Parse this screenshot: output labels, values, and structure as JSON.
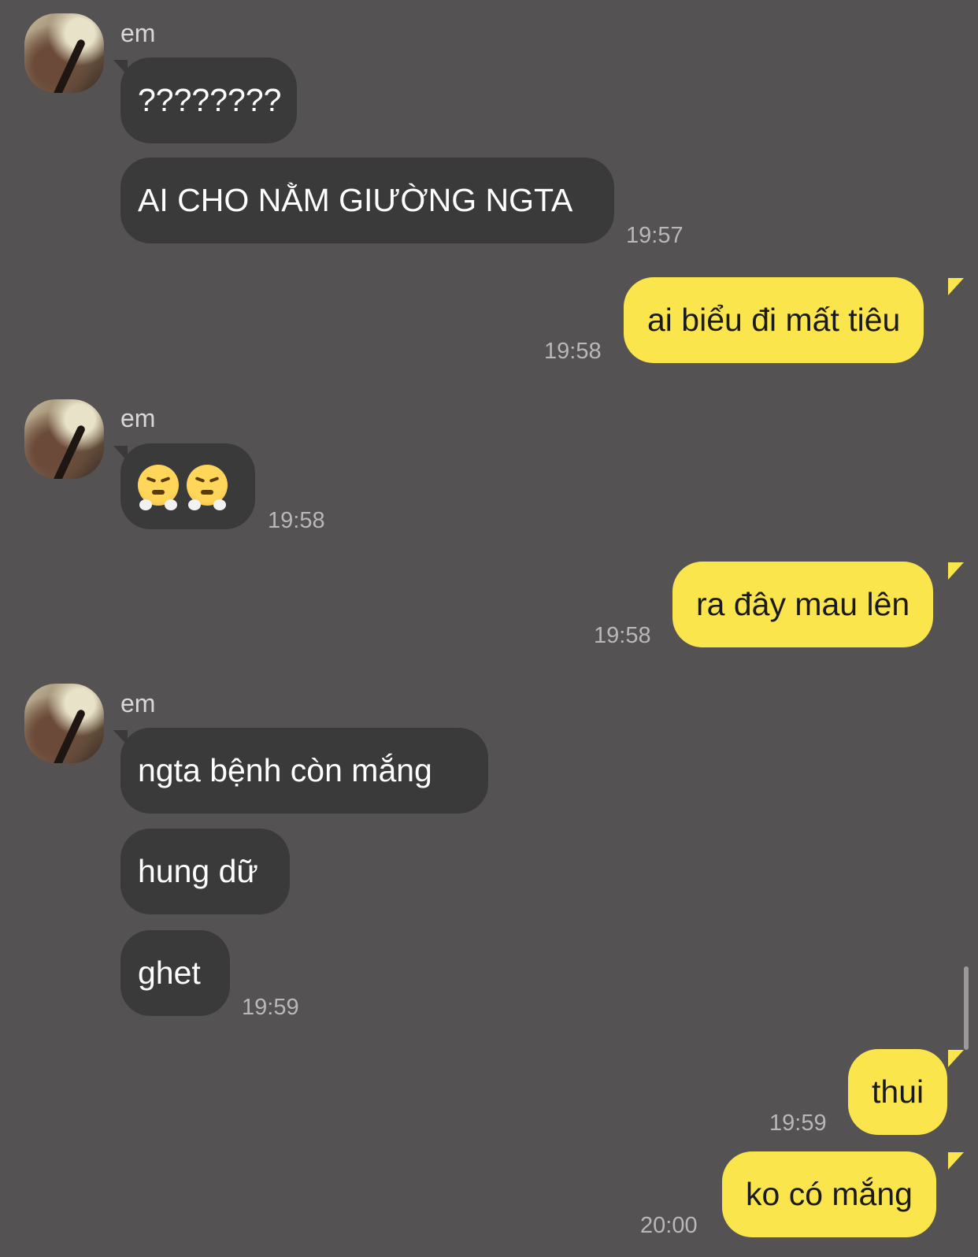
{
  "messages": [
    {
      "side": "in",
      "sender": "em",
      "text": "????????"
    },
    {
      "side": "in",
      "text": "AI CHO NẰM GIƯỜNG NGTA",
      "time": "19:57"
    },
    {
      "side": "out",
      "text": "ai biểu đi mất tiêu",
      "time": "19:58"
    },
    {
      "side": "in",
      "sender": "em",
      "emoji": [
        "angry-steam-face-emoji",
        "angry-steam-face-emoji"
      ],
      "time": "19:58"
    },
    {
      "side": "out",
      "text": "ra đây mau lên",
      "time": "19:58"
    },
    {
      "side": "in",
      "sender": "em",
      "text": "ngta bệnh còn mắng"
    },
    {
      "side": "in",
      "text": "hung dữ"
    },
    {
      "side": "in",
      "text": "ghet",
      "time": "19:59"
    },
    {
      "side": "out",
      "text": "thui",
      "time": "19:59"
    },
    {
      "side": "out",
      "text": "ko có mắng",
      "time": "20:00"
    }
  ],
  "colors": {
    "background": "#545253",
    "incoming_bubble": "#3b3a3b",
    "outgoing_bubble": "#fbe54d"
  }
}
